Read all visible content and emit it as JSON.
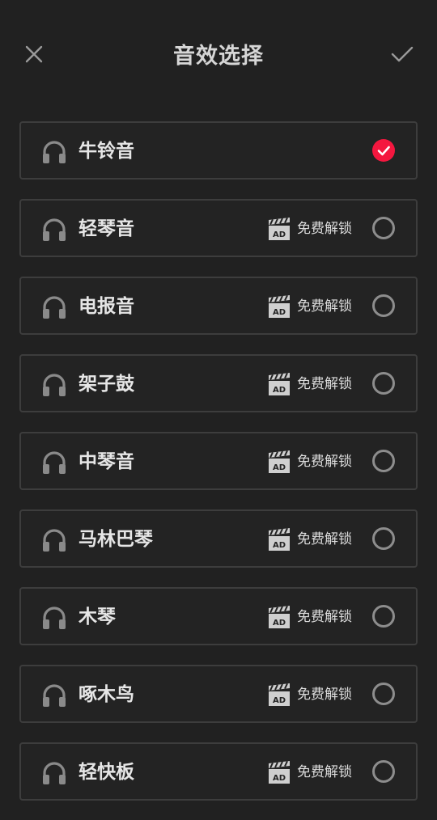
{
  "header": {
    "title": "音效选择",
    "close_icon": "close-icon",
    "confirm_icon": "check-icon"
  },
  "items": [
    {
      "name": "牛铃音",
      "selected": true,
      "locked": false
    },
    {
      "name": "轻琴音",
      "selected": false,
      "locked": true,
      "unlock_label": "免费解锁"
    },
    {
      "name": "电报音",
      "selected": false,
      "locked": true,
      "unlock_label": "免费解锁"
    },
    {
      "name": "架子鼓",
      "selected": false,
      "locked": true,
      "unlock_label": "免费解锁"
    },
    {
      "name": "中琴音",
      "selected": false,
      "locked": true,
      "unlock_label": "免费解锁"
    },
    {
      "name": "马林巴琴",
      "selected": false,
      "locked": true,
      "unlock_label": "免费解锁"
    },
    {
      "name": "木琴",
      "selected": false,
      "locked": true,
      "unlock_label": "免费解锁"
    },
    {
      "name": "啄木鸟",
      "selected": false,
      "locked": true,
      "unlock_label": "免费解锁"
    },
    {
      "name": "轻快板",
      "selected": false,
      "locked": true,
      "unlock_label": "免费解锁"
    }
  ],
  "icons": {
    "item": "headphones-icon",
    "ad": "ad-clapperboard-icon",
    "ad_badge": "AD"
  },
  "colors": {
    "background": "#212121",
    "selected_accent": "#f4173f",
    "border": "#3d3d3d"
  }
}
